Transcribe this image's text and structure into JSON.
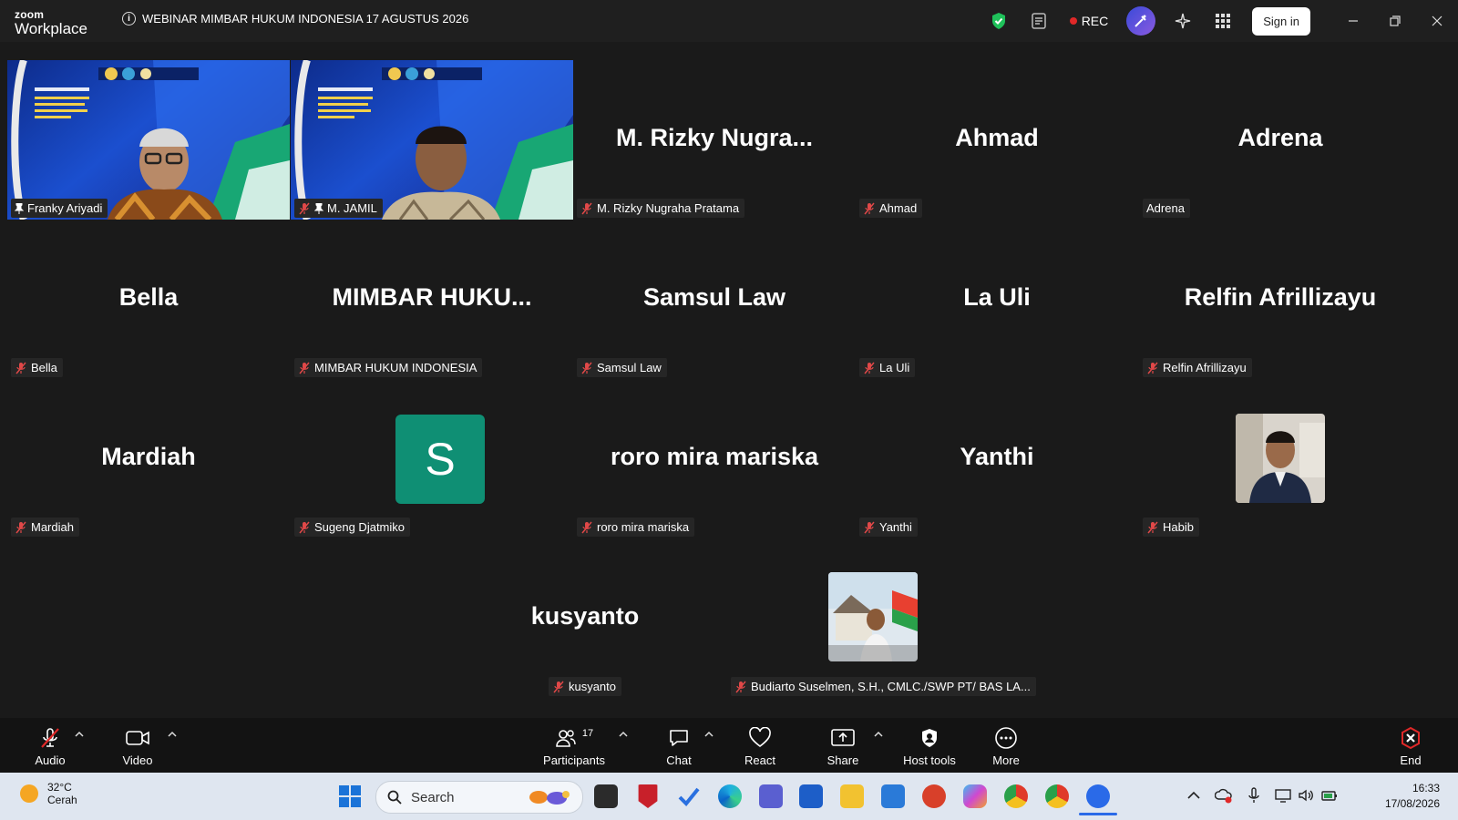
{
  "app": {
    "logo_top": "zoom",
    "logo_bottom": "Workplace",
    "meeting_title": "WEBINAR MIMBAR HUKUM INDONESIA 17 AGUSTUS 2026",
    "rec_label": "REC",
    "signin_label": "Sign in"
  },
  "tiles": [
    {
      "name": "Franky Ariyadi",
      "big": "",
      "video": true
    },
    {
      "name": "M. JAMIL",
      "big": "",
      "video": true
    },
    {
      "name": "M. Rizky Nugraha Pratama",
      "big": "M. Rizky Nugra..."
    },
    {
      "name": "Ahmad",
      "big": "Ahmad"
    },
    {
      "name": "Adrena",
      "big": "Adrena"
    },
    {
      "name": "Bella",
      "big": "Bella"
    },
    {
      "name": "MIMBAR HUKUM INDONESIA",
      "big": "MIMBAR HUKU..."
    },
    {
      "name": "Samsul Law",
      "big": "Samsul Law"
    },
    {
      "name": "La Uli",
      "big": "La Uli"
    },
    {
      "name": "Relfin Afrillizayu",
      "big": "Relfin Afrillizayu"
    },
    {
      "name": "Mardiah",
      "big": "Mardiah"
    },
    {
      "name": "Sugeng Djatmiko",
      "big": "",
      "avatar_letter": "S"
    },
    {
      "name": "roro mira mariska",
      "big": "roro mira mariska"
    },
    {
      "name": "Yanthi",
      "big": "Yanthi"
    },
    {
      "name": "Habib",
      "big": ""
    },
    {
      "name": "kusyanto",
      "big": "kusyanto"
    },
    {
      "name": "Budiarto Suselmen, S.H., CMLC./SWP PT/ BAS LA...",
      "big": ""
    }
  ],
  "toolbar": {
    "audio": "Audio",
    "video": "Video",
    "participants": "Participants",
    "participants_count": "17",
    "chat": "Chat",
    "react": "React",
    "share": "Share",
    "host_tools": "Host tools",
    "more": "More",
    "end": "End"
  },
  "taskbar": {
    "temp": "32°C",
    "weather": "Cerah",
    "search_placeholder": "Search",
    "time": "16:33",
    "date": "17/08/2026"
  },
  "colors": {
    "active_speaker": "#27e27f",
    "rec_dot": "#e02828",
    "avatar_bg": "#0f8f74",
    "end_red": "#e02828"
  }
}
